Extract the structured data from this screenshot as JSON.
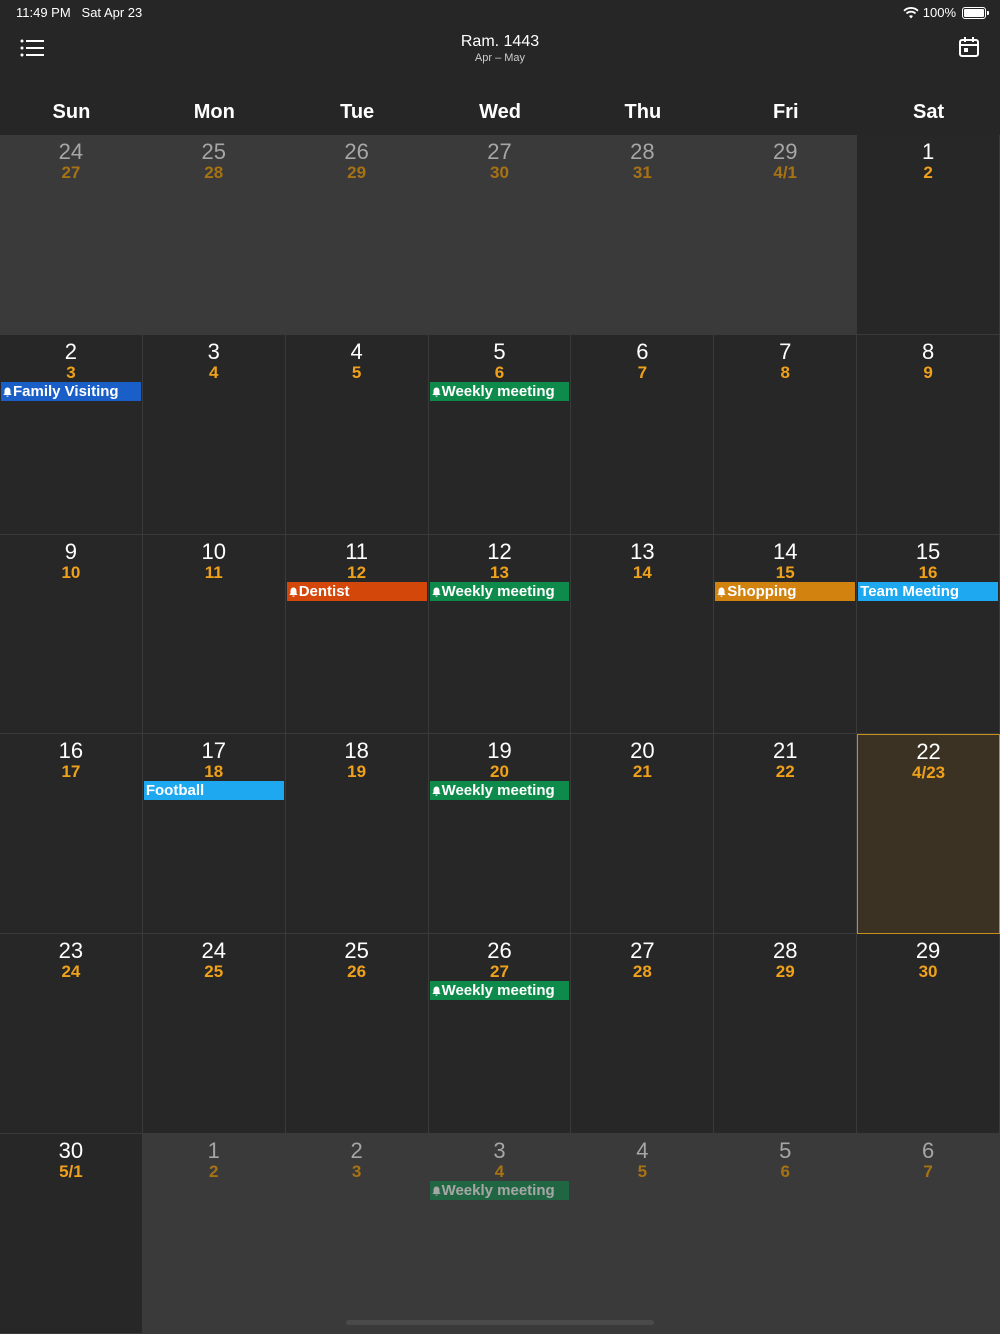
{
  "status": {
    "time": "11:49 PM",
    "date": "Sat Apr 23",
    "battery": "100%"
  },
  "header": {
    "title": "Ram. 1443",
    "subtitle": "Apr – May"
  },
  "icons": {
    "menu": "list-icon",
    "calendar": "calendar-icon",
    "wifi": "wifi-icon",
    "battery": "battery-icon",
    "bell": "bell-icon"
  },
  "colors": {
    "blue": "#1a5fc8",
    "green": "#0e8a4a",
    "red": "#d4470a",
    "orange": "#d2820e",
    "cyan": "#1ea8f0",
    "accent": "#f0a11a"
  },
  "weekdays": [
    "Sun",
    "Mon",
    "Tue",
    "Wed",
    "Thu",
    "Fri",
    "Sat"
  ],
  "weeks": [
    [
      {
        "g": "24",
        "h": "27",
        "other": true
      },
      {
        "g": "25",
        "h": "28",
        "other": true
      },
      {
        "g": "26",
        "h": "29",
        "other": true
      },
      {
        "g": "27",
        "h": "30",
        "other": true
      },
      {
        "g": "28",
        "h": "31",
        "other": true
      },
      {
        "g": "29",
        "h": "4/1",
        "other": true
      },
      {
        "g": "1",
        "h": "2"
      }
    ],
    [
      {
        "g": "2",
        "h": "3",
        "events": [
          {
            "title": "Family Visiting",
            "color": "blue",
            "bell": true
          }
        ]
      },
      {
        "g": "3",
        "h": "4"
      },
      {
        "g": "4",
        "h": "5"
      },
      {
        "g": "5",
        "h": "6",
        "events": [
          {
            "title": "Weekly meeting",
            "color": "green",
            "bell": true
          }
        ]
      },
      {
        "g": "6",
        "h": "7"
      },
      {
        "g": "7",
        "h": "8"
      },
      {
        "g": "8",
        "h": "9"
      }
    ],
    [
      {
        "g": "9",
        "h": "10"
      },
      {
        "g": "10",
        "h": "11"
      },
      {
        "g": "11",
        "h": "12",
        "events": [
          {
            "title": "Dentist",
            "color": "red",
            "bell": true
          }
        ]
      },
      {
        "g": "12",
        "h": "13",
        "events": [
          {
            "title": "Weekly meeting",
            "color": "green",
            "bell": true
          }
        ]
      },
      {
        "g": "13",
        "h": "14"
      },
      {
        "g": "14",
        "h": "15",
        "events": [
          {
            "title": "Shopping",
            "color": "orange",
            "bell": true
          }
        ]
      },
      {
        "g": "15",
        "h": "16",
        "events": [
          {
            "title": "Team Meeting",
            "color": "cyan",
            "bell": false
          }
        ]
      }
    ],
    [
      {
        "g": "16",
        "h": "17"
      },
      {
        "g": "17",
        "h": "18",
        "events": [
          {
            "title": "Football",
            "color": "cyan",
            "bell": false
          }
        ]
      },
      {
        "g": "18",
        "h": "19"
      },
      {
        "g": "19",
        "h": "20",
        "events": [
          {
            "title": "Weekly meeting",
            "color": "green",
            "bell": true
          }
        ]
      },
      {
        "g": "20",
        "h": "21"
      },
      {
        "g": "21",
        "h": "22"
      },
      {
        "g": "22",
        "h": "4/23",
        "today": true
      }
    ],
    [
      {
        "g": "23",
        "h": "24"
      },
      {
        "g": "24",
        "h": "25"
      },
      {
        "g": "25",
        "h": "26"
      },
      {
        "g": "26",
        "h": "27",
        "events": [
          {
            "title": "Weekly meeting",
            "color": "green",
            "bell": true
          }
        ]
      },
      {
        "g": "27",
        "h": "28"
      },
      {
        "g": "28",
        "h": "29"
      },
      {
        "g": "29",
        "h": "30"
      }
    ],
    [
      {
        "g": "30",
        "h": "5/1"
      },
      {
        "g": "1",
        "h": "2",
        "other": true
      },
      {
        "g": "2",
        "h": "3",
        "other": true
      },
      {
        "g": "3",
        "h": "4",
        "other": true,
        "events": [
          {
            "title": "Weekly meeting",
            "color": "green",
            "bell": true
          }
        ]
      },
      {
        "g": "4",
        "h": "5",
        "other": true
      },
      {
        "g": "5",
        "h": "6",
        "other": true
      },
      {
        "g": "6",
        "h": "7",
        "other": true
      }
    ]
  ]
}
